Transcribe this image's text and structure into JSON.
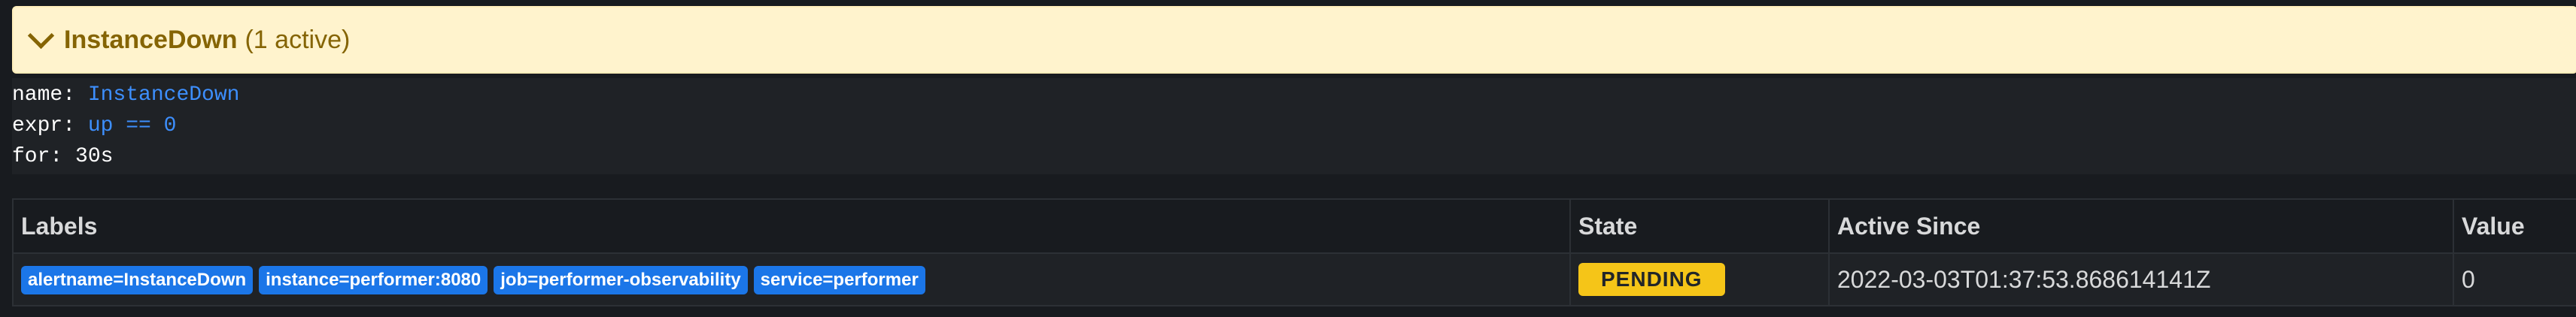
{
  "alert": {
    "name": "InstanceDown",
    "active_count": "(1 active)"
  },
  "rule": {
    "name_key": "name: ",
    "name_value": "InstanceDown",
    "expr_key": "expr: ",
    "expr_value": "up == 0",
    "for_key": "for: ",
    "for_value": "30s"
  },
  "table": {
    "headers": {
      "labels": "Labels",
      "state": "State",
      "active_since": "Active Since",
      "value": "Value"
    },
    "rows": [
      {
        "labels": [
          "alertname=InstanceDown",
          "instance=performer:8080",
          "job=performer-observability",
          "service=performer"
        ],
        "state": "PENDING",
        "active_since": "2022-03-03T01:37:53.868614141Z",
        "value": "0"
      }
    ]
  },
  "colors": {
    "header_bg": "#fff3cd",
    "header_text": "#856404",
    "label_badge": "#1b76e8",
    "pending_badge": "#f5c518",
    "code_blue": "#3d8ffe"
  }
}
